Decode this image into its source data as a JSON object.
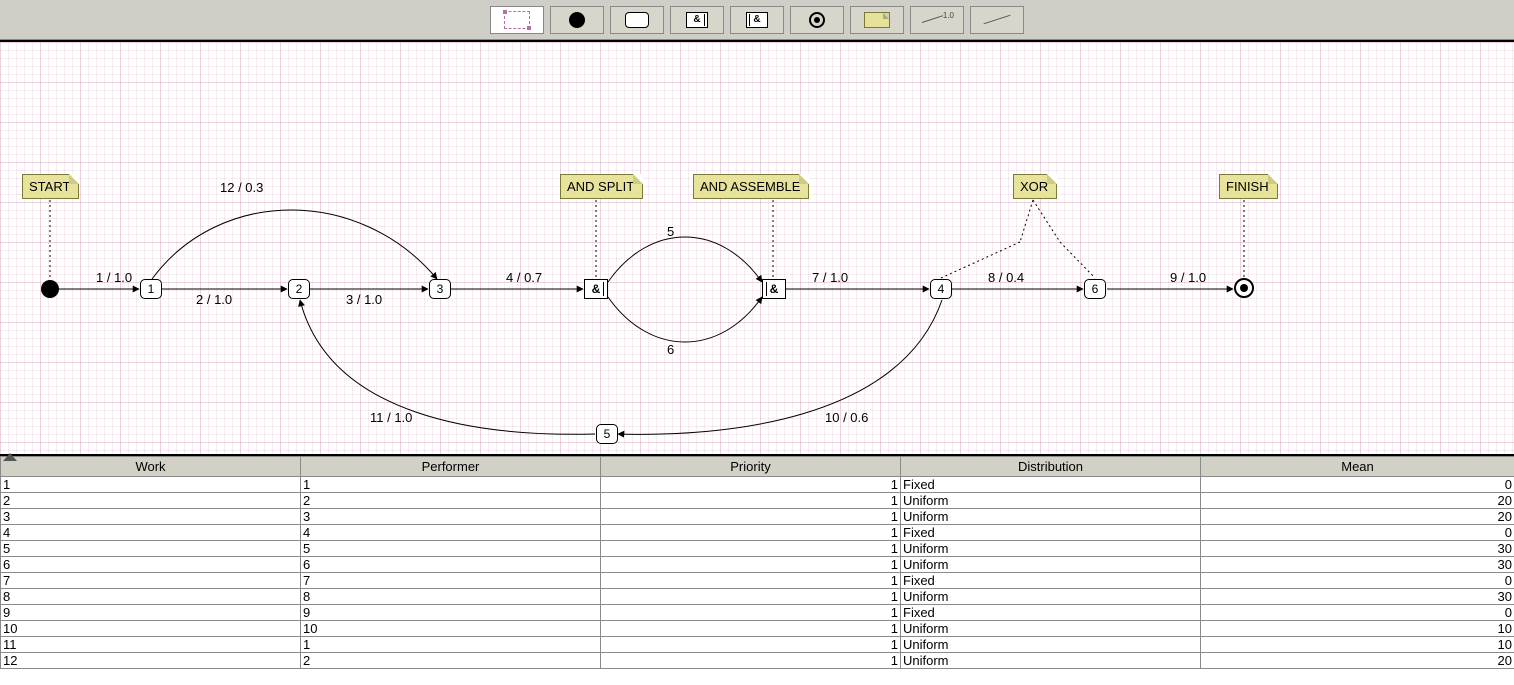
{
  "toolbar": {
    "tools": [
      {
        "name": "selection-tool",
        "icon": "selection"
      },
      {
        "name": "start-node-tool",
        "icon": "solid-circle"
      },
      {
        "name": "activity-tool",
        "icon": "rounded-rect"
      },
      {
        "name": "and-split-tool",
        "icon": "and-split",
        "glyph": "&"
      },
      {
        "name": "and-assemble-tool",
        "icon": "and-assemble",
        "glyph": "&"
      },
      {
        "name": "end-node-tool",
        "icon": "end-circle"
      },
      {
        "name": "note-tool",
        "icon": "note"
      },
      {
        "name": "labeled-edge-tool",
        "icon": "edge-label"
      },
      {
        "name": "line-tool",
        "icon": "line"
      }
    ]
  },
  "notes": {
    "start": "START",
    "and_split": "AND SPLIT",
    "and_assemble": "AND ASSEMBLE",
    "xor": "XOR",
    "finish": "FINISH"
  },
  "gates": {
    "split_glyph": "&",
    "assemble_glyph": "&"
  },
  "activities": {
    "a1": "1",
    "a2": "2",
    "a3": "3",
    "a4": "4",
    "a5": "5",
    "a6": "6"
  },
  "edge_labels": {
    "e1": "1 / 1.0",
    "e2": "2 / 1.0",
    "e3": "3 / 1.0",
    "e4": "4 / 0.7",
    "e5": "5",
    "e6": "6",
    "e7": "7 / 1.0",
    "e8": "8 / 0.4",
    "e9": "9 / 1.0",
    "e10": "10 / 0.6",
    "e11": "11 / 1.0",
    "e12": "12 / 0.3"
  },
  "table": {
    "headers": {
      "work": "Work",
      "performer": "Performer",
      "priority": "Priority",
      "distribution": "Distribution",
      "mean": "Mean"
    },
    "rows": [
      {
        "work": "1",
        "performer": "1",
        "priority": "1",
        "distribution": "Fixed",
        "mean": "0"
      },
      {
        "work": "2",
        "performer": "2",
        "priority": "1",
        "distribution": "Uniform",
        "mean": "20"
      },
      {
        "work": "3",
        "performer": "3",
        "priority": "1",
        "distribution": "Uniform",
        "mean": "20"
      },
      {
        "work": "4",
        "performer": "4",
        "priority": "1",
        "distribution": "Fixed",
        "mean": "0"
      },
      {
        "work": "5",
        "performer": "5",
        "priority": "1",
        "distribution": "Uniform",
        "mean": "30"
      },
      {
        "work": "6",
        "performer": "6",
        "priority": "1",
        "distribution": "Uniform",
        "mean": "30"
      },
      {
        "work": "7",
        "performer": "7",
        "priority": "1",
        "distribution": "Fixed",
        "mean": "0"
      },
      {
        "work": "8",
        "performer": "8",
        "priority": "1",
        "distribution": "Uniform",
        "mean": "30"
      },
      {
        "work": "9",
        "performer": "9",
        "priority": "1",
        "distribution": "Fixed",
        "mean": "0"
      },
      {
        "work": "10",
        "performer": "10",
        "priority": "1",
        "distribution": "Uniform",
        "mean": "10"
      },
      {
        "work": "11",
        "performer": "1",
        "priority": "1",
        "distribution": "Uniform",
        "mean": "10"
      },
      {
        "work": "12",
        "performer": "2",
        "priority": "1",
        "distribution": "Uniform",
        "mean": "20"
      }
    ]
  }
}
